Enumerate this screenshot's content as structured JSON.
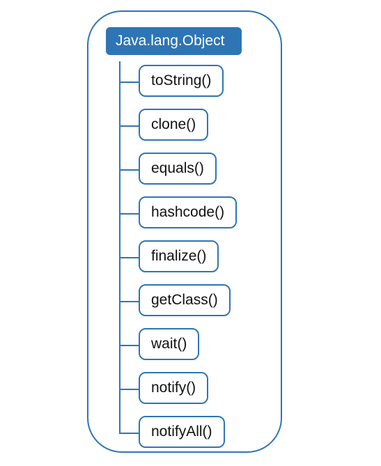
{
  "root": {
    "label": "Java.lang.Object"
  },
  "methods": [
    {
      "label": "toString()"
    },
    {
      "label": "clone()"
    },
    {
      "label": "equals()"
    },
    {
      "label": "hashcode()"
    },
    {
      "label": "finalize()"
    },
    {
      "label": "getClass()"
    },
    {
      "label": "wait()"
    },
    {
      "label": "notify()"
    },
    {
      "label": "notifyAll()"
    }
  ],
  "colors": {
    "accent": "#2e75b6",
    "text": "#111111",
    "background": "#ffffff"
  }
}
